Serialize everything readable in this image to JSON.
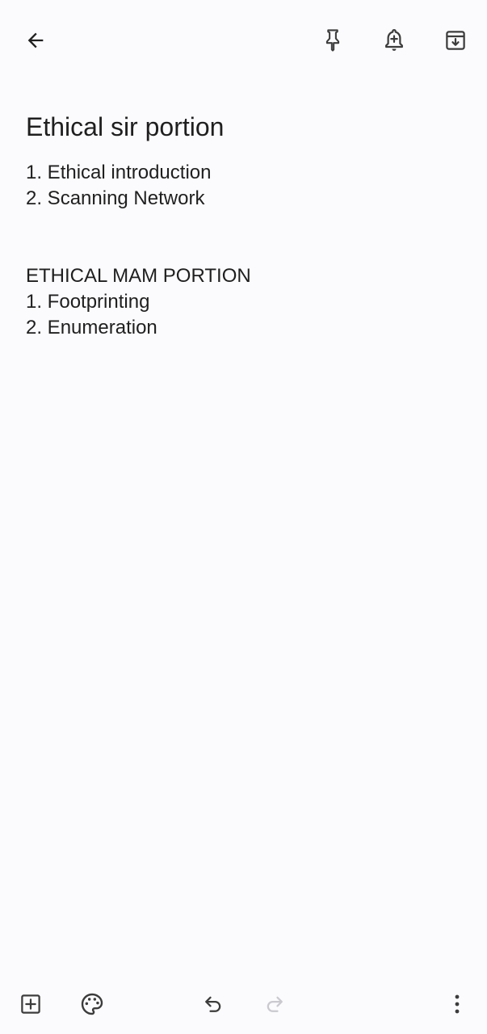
{
  "toolbar": {
    "back_icon": "arrow-back-icon",
    "pin_icon": "pin-icon",
    "reminder_icon": "add-alert-icon",
    "archive_icon": "archive-icon"
  },
  "note": {
    "title": "Ethical sir portion",
    "lines": [
      "1. Ethical introduction",
      "2. Scanning Network",
      "",
      "",
      "ETHICAL MAM PORTION",
      "1. Footprinting",
      "2. Enumeration"
    ]
  },
  "bottom_bar": {
    "add_icon": "add-box-icon",
    "palette_icon": "palette-icon",
    "undo_icon": "undo-icon",
    "redo_icon": "redo-icon",
    "more_icon": "more-vert-icon"
  },
  "colors": {
    "background": "#fbfafd",
    "icon": "#3c3c3c",
    "icon_disabled": "#c9c9cf",
    "text": "#1f1f1f"
  }
}
